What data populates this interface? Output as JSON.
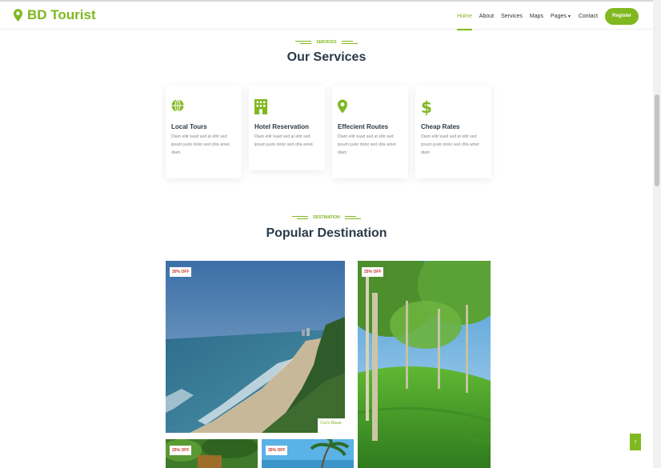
{
  "brand": {
    "name": "BD Tourist"
  },
  "nav": {
    "home": "Home",
    "about": "About",
    "services": "Services",
    "maps": "Maps",
    "pages": "Pages",
    "contact": "Contact",
    "register": "Register"
  },
  "services": {
    "tag": "SERVICES",
    "title": "Our Services",
    "items": [
      {
        "title": "Local Tours",
        "icon": "globe-icon",
        "text": "Diam elitr kasd sed at elitr sed ipsum justo dolor sed clita amet diam"
      },
      {
        "title": "Hotel Reservation",
        "icon": "hotel-icon",
        "text": "Diam elitr kasd sed at elitr sed ipsum justo dolor sed clita amet."
      },
      {
        "title": "Effecient Routes",
        "icon": "map-marker-icon",
        "text": "Diam elitr kasd sed at elitr sed ipsum justo dolor sed clita amet diam"
      },
      {
        "title": "Cheap Rates",
        "icon": "dollar-icon",
        "text": "Diam elitr kasd sed at elitr sed ipsum justo dolor sed clita amet diam"
      }
    ]
  },
  "destination": {
    "tag": "DESTINATION",
    "title": "Popular Destination",
    "items": [
      {
        "badge": "30% OFF",
        "place": "Cox's Bazar"
      },
      {
        "badge": "25% OFF"
      },
      {
        "badge": "25% OFF"
      },
      {
        "badge": "35% OFF"
      }
    ]
  },
  "colors": {
    "accent": "#7fb81f",
    "badge_text": "#c0392b",
    "heading": "#2b3a4a"
  }
}
